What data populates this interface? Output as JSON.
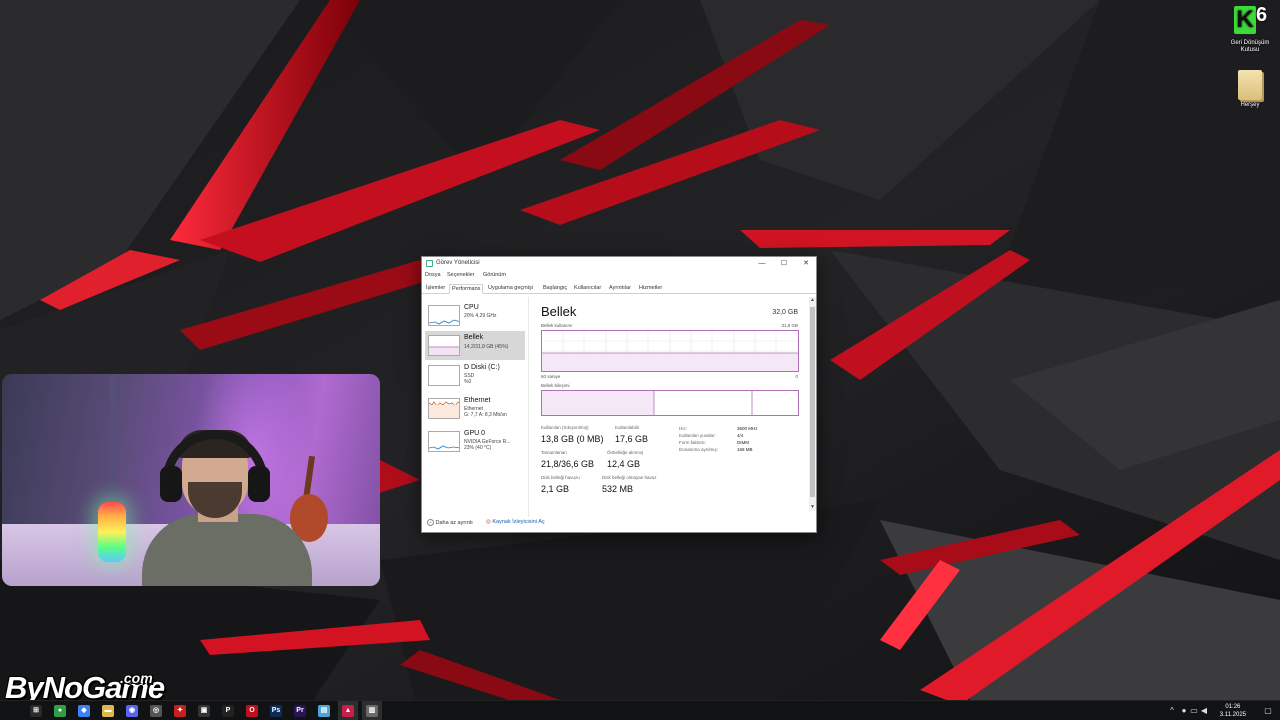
{
  "desktop": {
    "recycle_bin": {
      "badge_letter": "K",
      "badge_number": "6",
      "label_line1": "Geri Dönüşüm",
      "label_line2": "Kutusu"
    },
    "folder": {
      "label": "Herşey"
    }
  },
  "channel_logo": {
    "name": "ByNoGame",
    "suffix": ".com"
  },
  "task_manager": {
    "title": "Görev Yöneticisi",
    "window_buttons": {
      "minimize": "—",
      "maximize": "☐",
      "close": "✕"
    },
    "menu": [
      "Dosya",
      "Seçenekler",
      "Görünüm"
    ],
    "tabs": [
      "İşlemler",
      "Performans",
      "Uygulama geçmişi",
      "Başlangıç",
      "Kullanıcılar",
      "Ayrıntılar",
      "Hizmetler"
    ],
    "active_tab": "Performans",
    "sidebar": [
      {
        "title": "CPU",
        "sub1": "20% 4,29 GHz",
        "sub2": "",
        "sub3": ""
      },
      {
        "title": "Bellek",
        "sub1": "14,2/31,8 GB (45%)",
        "sub2": "",
        "sub3": ""
      },
      {
        "title": "D Diski (C:)",
        "sub1": "SSD",
        "sub2": "%0",
        "sub3": ""
      },
      {
        "title": "Ethernet",
        "sub1": "Ethernet",
        "sub2": "G: 7,7  A: 8,3 Mb/sn",
        "sub3": ""
      },
      {
        "title": "GPU 0",
        "sub1": "NVIDIA GeForce R...",
        "sub2": "23% (40 °C)",
        "sub3": ""
      }
    ],
    "memory": {
      "title": "Bellek",
      "total": "32,0 GB",
      "usage_label": "Bellek kullanımı",
      "usage_max": "31,8 GB",
      "graph_left": "60 saniye",
      "graph_right": "0",
      "composition_label": "Bellek bileşimi",
      "usage_fraction": 0.45,
      "stats": [
        {
          "label": "Kullanılan (Sıkıştırılmış)",
          "value": "13,8 GB (0 MB)"
        },
        {
          "label": "Kullanılabilir",
          "value": "17,6 GB"
        },
        {
          "label": "Tamamlanan",
          "value": "21,8/36,6 GB"
        },
        {
          "label": "Önbelleğe alınmış",
          "value": "12,4 GB"
        },
        {
          "label": "Disk belleği havuzu",
          "value": "2,1 GB"
        },
        {
          "label": "Disk belleği olmayan havuz",
          "value": "532 MB"
        }
      ],
      "specs": [
        {
          "label": "Hız:",
          "value": "3600 MHz"
        },
        {
          "label": "Kullanılan yuvalar:",
          "value": "4/4"
        },
        {
          "label": "Form faktörü:",
          "value": "DIMM"
        },
        {
          "label": "Donanıma ayrılmış:",
          "value": "168 MB"
        }
      ]
    },
    "footer": {
      "less_details": "Daha az ayrıntı",
      "resource_monitor": "Kaynak İzleyicisini Aç"
    }
  },
  "taskbar": {
    "apps": [
      {
        "name": "start",
        "glyph": "⊞",
        "color": "#2a2a2a"
      },
      {
        "name": "chrome",
        "glyph": "●",
        "color": "#2f9e44"
      },
      {
        "name": "store",
        "glyph": "◆",
        "color": "#3b82f6"
      },
      {
        "name": "folder",
        "glyph": "▬",
        "color": "#e0b84a"
      },
      {
        "name": "discord",
        "glyph": "◉",
        "color": "#5865f2"
      },
      {
        "name": "steam",
        "glyph": "◎",
        "color": "#555"
      },
      {
        "name": "red-app",
        "glyph": "✦",
        "color": "#c81e1e"
      },
      {
        "name": "armoury",
        "glyph": "▣",
        "color": "#333"
      },
      {
        "name": "playstation",
        "glyph": "P",
        "color": "#222"
      },
      {
        "name": "opera-gx",
        "glyph": "O",
        "color": "#c01020"
      },
      {
        "name": "photoshop",
        "glyph": "Ps",
        "color": "#0b2c5a"
      },
      {
        "name": "premiere",
        "glyph": "Pr",
        "color": "#2a1458"
      },
      {
        "name": "notepad",
        "glyph": "▤",
        "color": "#4fa3d9"
      },
      {
        "name": "stream-app",
        "glyph": "▲",
        "color": "#c81e4a"
      },
      {
        "name": "task-manager",
        "glyph": "▥",
        "color": "#6a6a6a"
      }
    ],
    "clock_time": "01:26",
    "clock_date": "3.11.2025"
  },
  "colors": {
    "memory_accent": "#b070b8",
    "wallpaper_red": "#d4101f"
  }
}
